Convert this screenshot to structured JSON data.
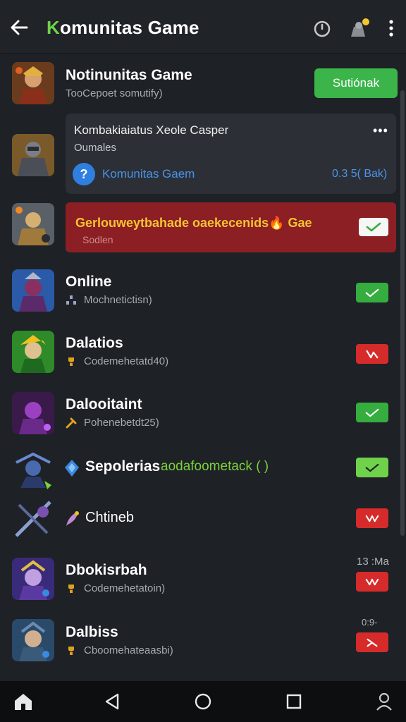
{
  "header": {
    "title_first": "K",
    "title_rest": "omunitas Game"
  },
  "top_item": {
    "name": "Notinunitas Game",
    "sub": "TooCepoet somutify)",
    "join_label": "Sutiónak"
  },
  "card": {
    "title": "Kombakiaiatus Xeole Casper",
    "sub": "Oumales",
    "dots": "•••",
    "icon_text": "?",
    "link": "Komunitas Gaem",
    "meta": "0.3 5( Bak)"
  },
  "banner": {
    "title": "Gerlouweytbahade oaekecenids🔥 Gae",
    "sub": "Sodlen"
  },
  "rows": [
    {
      "name": "Online",
      "sub": "Mochnetictisn)",
      "status": "ok"
    },
    {
      "name": "Dalatios",
      "sub": "Codemehetatd40)",
      "status": "no"
    },
    {
      "name": "Dalooitaint",
      "sub": "Pohenebetdt25)",
      "status": "ok"
    },
    {
      "name": "Sepolerias",
      "note": "aodafoometack ( )",
      "status": "ok"
    },
    {
      "name": "Chtineb",
      "status": "no"
    },
    {
      "name": "Dbokisrbah",
      "sub": "Codemehetatoin)",
      "time": "13 :Ma",
      "status": "no"
    },
    {
      "name": "Dalbiss",
      "sub": "Cboomehateaasbi)",
      "time": "0:9-",
      "status": "no"
    }
  ],
  "colors": {
    "background": "#1e2126",
    "accent_green": "#3bb54a",
    "danger_red": "#d62b2b",
    "link_blue": "#4a93ea",
    "banner_red": "#8c1f24",
    "banner_text": "#f5c430"
  },
  "icons": [
    "back-arrow-icon",
    "timer-icon",
    "profile-badge-icon",
    "more-vert-icon",
    "home-icon",
    "nav-back-icon",
    "nav-home-icon",
    "recents-icon",
    "account-icon"
  ]
}
